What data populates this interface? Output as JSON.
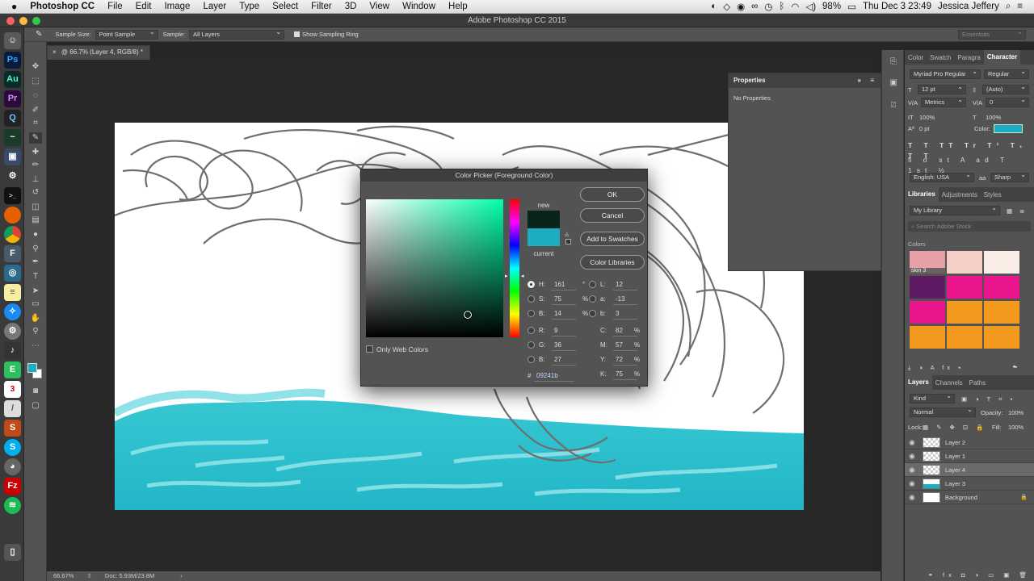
{
  "menubar": {
    "apple": "",
    "app": "Photoshop CC",
    "items": [
      "File",
      "Edit",
      "Image",
      "Layer",
      "Type",
      "Select",
      "Filter",
      "3D",
      "View",
      "Window",
      "Help"
    ],
    "battery": "98%",
    "datetime": "Thu Dec 3  23:49",
    "user": "Jessica Jeffery"
  },
  "window": {
    "title": "Adobe Photoshop CC 2015"
  },
  "options": {
    "sample_size_label": "Sample Size:",
    "sample_size": "Point Sample",
    "sample_label": "Sample:",
    "sample": "All Layers",
    "show_ring": "Show Sampling Ring",
    "workspace": "Essentials"
  },
  "document": {
    "tab": "@ 66.7% (Layer 4, RGB/8) *",
    "close": "×"
  },
  "status": {
    "zoom": "66.67%",
    "doc": "Doc: 5.93M/23.8M"
  },
  "properties": {
    "title": "Properties",
    "body": "No Properties"
  },
  "character": {
    "tabs": [
      "Color",
      "Swatch",
      "Paragra",
      "Character"
    ],
    "font": "Myriad Pro Regular",
    "style": "Regular",
    "size": "12 pt",
    "leading": "(Auto)",
    "kerning": "Metrics",
    "tracking": "0",
    "vscale": "100%",
    "hscale": "100%",
    "baseline": "0 pt",
    "color_label": "Color:",
    "color": "#1aaec0",
    "language": "English: USA",
    "aa": "aa",
    "sharp": "Sharp"
  },
  "libraries": {
    "tabs": [
      "Libraries",
      "Adjustments",
      "Styles"
    ],
    "library": "My Library",
    "search": "Search Adobe Stock",
    "colors_label": "Colors",
    "swatch_label": "skin 3",
    "swatches": [
      "#e6a0a6",
      "#f4cfc6",
      "#f9ede6",
      "#5e1a63",
      "#e8158c",
      "#e8158c",
      "#e8158c",
      "#f39a1e",
      "#f39a1e",
      "#f39a1e",
      "#f39a1e",
      "#f39a1e"
    ]
  },
  "layers": {
    "tabs": [
      "Layers",
      "Channels",
      "Paths"
    ],
    "kind": "Kind",
    "blend": "Normal",
    "opacity_label": "Opacity:",
    "opacity": "100%",
    "lock_label": "Lock:",
    "fill_label": "Fill:",
    "fill": "100%",
    "items": [
      {
        "name": "Layer 2",
        "selected": false
      },
      {
        "name": "Layer 1",
        "selected": false
      },
      {
        "name": "Layer 4",
        "selected": true
      },
      {
        "name": "Layer 3",
        "selected": false
      },
      {
        "name": "Background",
        "selected": false
      }
    ]
  },
  "picker": {
    "title": "Color Picker (Foreground Color)",
    "ok": "OK",
    "cancel": "Cancel",
    "add_swatches": "Add to Swatches",
    "color_libraries": "Color Libraries",
    "new_label": "new",
    "current_label": "current",
    "new_color": "#09241b",
    "current_color": "#1aaec0",
    "only_web": "Only Web Colors",
    "hex_label": "#",
    "hex": "09241b",
    "fields": {
      "H": "161",
      "S": "75",
      "B": "14",
      "R": "9",
      "G": "36",
      "B2": "27",
      "L": "12",
      "a": "-13",
      "b": "3",
      "C": "82",
      "M": "57",
      "Y": "72",
      "K": "75"
    },
    "units": {
      "deg": "°",
      "pct": "%"
    },
    "labels": {
      "H": "H:",
      "S": "S:",
      "B": "B:",
      "R": "R:",
      "G": "G:",
      "B2": "B:",
      "L": "L:",
      "a": "a:",
      "b": "b:",
      "C": "C:",
      "M": "M:",
      "Y": "Y:",
      "K": "K:"
    }
  }
}
